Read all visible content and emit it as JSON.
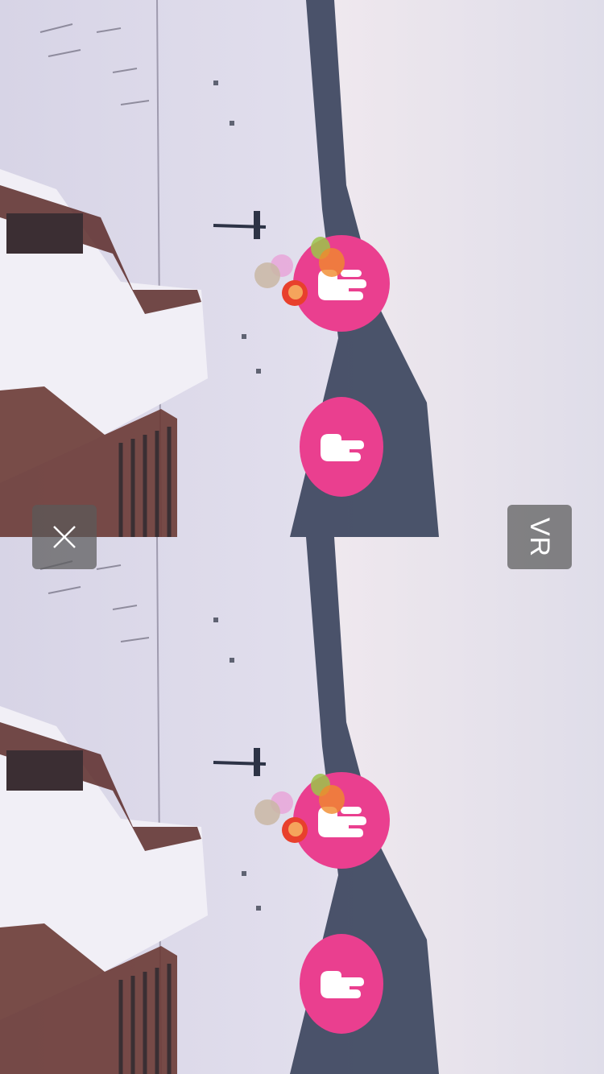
{
  "overlay": {
    "close_icon": "close-icon",
    "vr_label": "VR"
  },
  "eyes": [
    {
      "name": "left-eye"
    },
    {
      "name": "right-eye"
    }
  ],
  "buttons": {
    "like_icon": "rock-hand-icon",
    "gesture_icon": "pointing-hand-icon",
    "accent_color": "#ea3f8f"
  },
  "bubble_colors": [
    "#9cc44a",
    "#f08a2c",
    "#e9a3d8",
    "#c9b7a4",
    "#e8402c"
  ]
}
